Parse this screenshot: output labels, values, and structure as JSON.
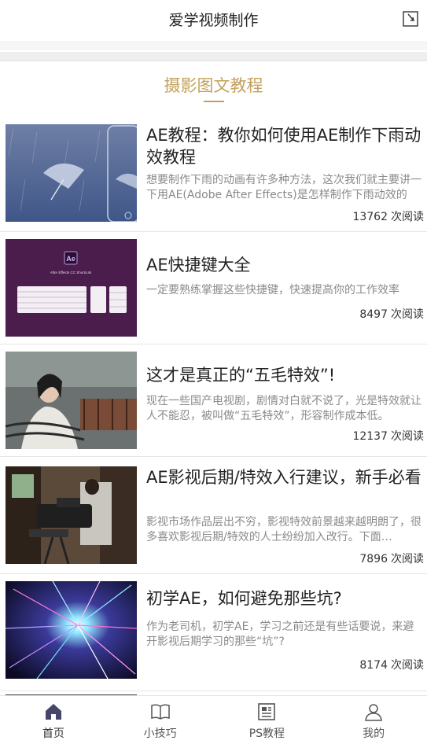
{
  "header": {
    "title": "爱学视频制作",
    "action_icon": "bookmark-icon"
  },
  "section": {
    "title": "摄影图文教程",
    "accent": "#c3a15c"
  },
  "articles": [
    {
      "title": "AE教程：教你如何使用AE制作下雨动效教程",
      "desc": "想要制作下雨的动画有许多种方法，这次我们就主要讲一下用AE(Adobe After Effects)是怎样制作下雨动效的",
      "reads": "13762",
      "reads_unit": "次阅读"
    },
    {
      "title": "AE快捷键大全",
      "desc": "一定要熟练掌握这些快捷键，快速提高你的工作效率",
      "reads": "8497",
      "reads_unit": "次阅读",
      "thumb_badge": "Ae",
      "thumb_caption": "After Effects CC Shortcuts"
    },
    {
      "title": "这才是真正的“五毛特效”!",
      "desc": "现在一些国产电视剧，剧情对白就不说了，光是特效就让人不能忍，被叫做“五毛特效”，形容制作成本低。",
      "reads": "12137",
      "reads_unit": "次阅读"
    },
    {
      "title": "AE影视后期/特效入行建议，新手必看",
      "desc": "影视市场作品层出不穷，影视特效前景越来越明朗了，很多喜欢影视后期/特效的人士纷纷加入改行。下面…",
      "reads": "7896",
      "reads_unit": "次阅读"
    },
    {
      "title": "初学AE，如何避免那些坑?",
      "desc": "作为老司机，初学AE，学习之前还是有些话要说，来避开影视后期学习的那些“坑”?",
      "reads": "8174",
      "reads_unit": "次阅读"
    }
  ],
  "tabbar": [
    {
      "label": "首页",
      "icon": "home-icon",
      "active": true
    },
    {
      "label": "小技巧",
      "icon": "book-icon",
      "active": false
    },
    {
      "label": "PS教程",
      "icon": "news-icon",
      "active": false
    },
    {
      "label": "我的",
      "icon": "user-icon",
      "active": false
    }
  ]
}
